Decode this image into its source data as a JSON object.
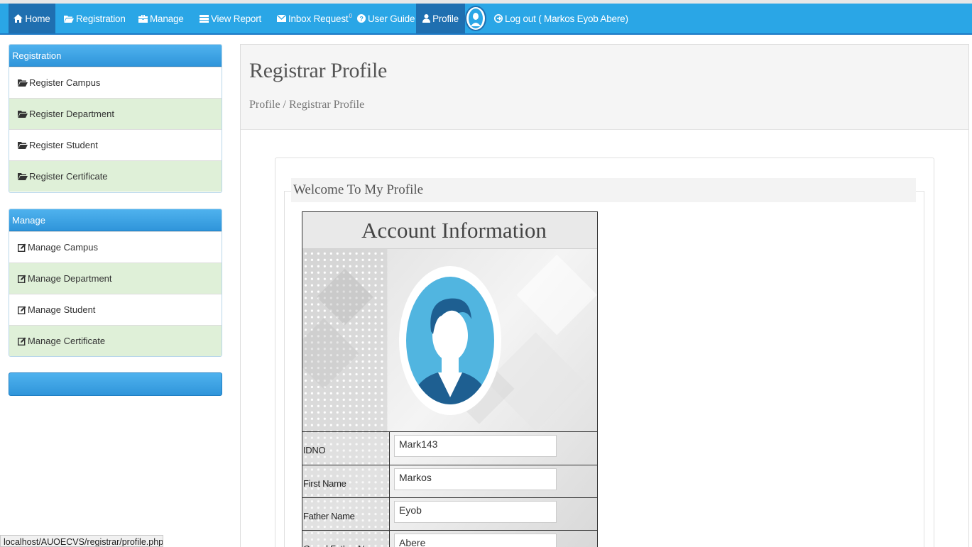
{
  "navbar": {
    "items": [
      {
        "label": "Home",
        "icon": "home-icon"
      },
      {
        "label": "Registration",
        "icon": "folder-open-icon"
      },
      {
        "label": "Manage",
        "icon": "briefcase-icon"
      },
      {
        "label": "View Report",
        "icon": "list-icon"
      },
      {
        "label": "Inbox Request",
        "icon": "envelope-icon",
        "badge": "0"
      },
      {
        "label": "User Guide",
        "icon": "question-circle-icon"
      },
      {
        "label": "Profile",
        "icon": "user-icon"
      },
      {
        "label": "Log out ( Markos Eyob Abere)",
        "icon": "log-out-icon"
      }
    ],
    "active": "Profile",
    "colors": {
      "bar": "#2aa6e6",
      "active": "#1f6fb0"
    }
  },
  "sidebar": {
    "registration": {
      "heading": "Registration",
      "items": [
        "Register Campus",
        "Register Department",
        "Register Student",
        "Register Certificate"
      ]
    },
    "manage": {
      "heading": "Manage",
      "items": [
        "Manage Campus",
        "Manage Department",
        "Manage Student",
        "Manage Certificate"
      ]
    },
    "colors": {
      "heading": "#2f95da",
      "alt_row": "#dff0d8"
    }
  },
  "main": {
    "title": "Registrar Profile",
    "breadcrumb": "Profile / Registrar Profile",
    "legend": "Welcome To My Profile",
    "card": {
      "title": "Account Information",
      "fields": [
        {
          "label": "IDNO",
          "value": "Mark143"
        },
        {
          "label": "First Name",
          "value": "Markos"
        },
        {
          "label": "Father Name",
          "value": "Eyob"
        },
        {
          "label": "Grand Father Name",
          "value": "Abere"
        }
      ]
    }
  },
  "status_bar": {
    "url": "localhost/AUOECVS/registrar/profile.php"
  }
}
